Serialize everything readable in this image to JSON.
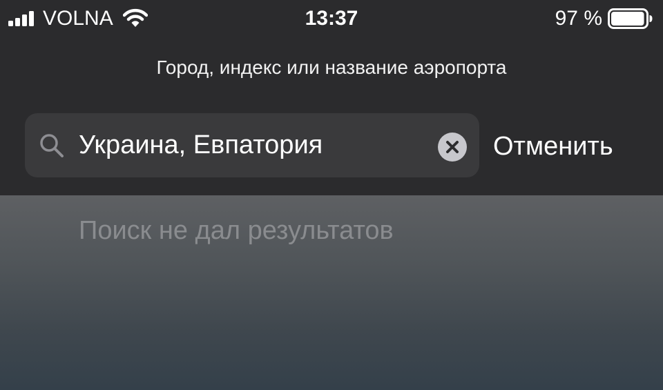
{
  "status_bar": {
    "carrier": "VOLNA",
    "time": "13:37",
    "battery_percent": "97 %",
    "battery_level": 0.97,
    "icons": [
      "signal-bars-icon",
      "wifi-icon",
      "battery-icon"
    ]
  },
  "search": {
    "hint": "Город, индекс или название аэропорта",
    "value": "Украина, Евпатория",
    "cancel_label": "Отменить",
    "icons": [
      "search-icon",
      "clear-icon"
    ]
  },
  "results": {
    "empty_message": "Поиск не дал результатов"
  },
  "colors": {
    "panel_background": "#2b2b2d",
    "field_background": "#3a3a3c",
    "text_primary": "#ffffff",
    "text_muted": "#8a8c8f",
    "clear_button": "#c7c7cc"
  }
}
